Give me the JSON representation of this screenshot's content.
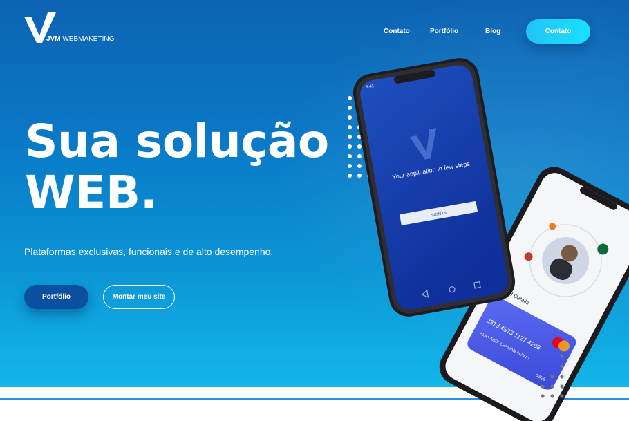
{
  "brand": {
    "name_bold": "JVM",
    "name_rest": "WEBMAKETING",
    "logo_icon": "v-logo-icon"
  },
  "nav": {
    "contato": "Contato",
    "portfolio": "Portfólio",
    "blog": "Blog",
    "cta": "Contato"
  },
  "hero": {
    "title_line1": "Sua solução",
    "title_line2": "WEB.",
    "subtitle": "Plataformas exclusivas, funcionais e de alto desempenho.",
    "btn_primary": "Portfólio",
    "btn_secondary": "Montar meu site"
  },
  "phone1": {
    "time": "9:41",
    "tagline": "Your application in few steps",
    "button": "SIGN IN"
  },
  "phone2": {
    "section": "Card Details",
    "card_number": "2313 4573 1127 4298",
    "card_name": "ALAA ABDULRHMAN ALFAKI",
    "card_expiry": "03/25"
  },
  "colors": {
    "hero_top": "#0d63b3",
    "hero_bottom": "#13b7e9",
    "accent": "#22c4f4",
    "primary_button": "#0a4fa0",
    "divider": "#2a8fe8"
  }
}
